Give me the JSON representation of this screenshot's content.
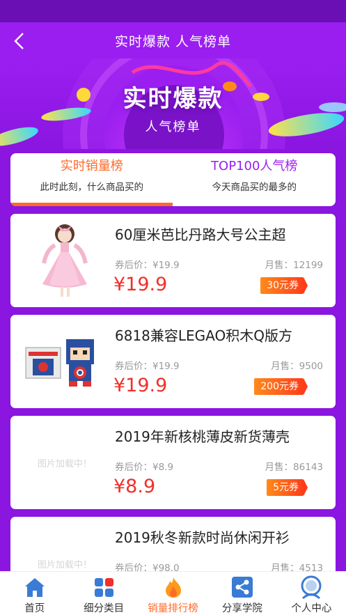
{
  "header": {
    "title": "实时爆款 人气榜单"
  },
  "banner": {
    "title": "实时爆款",
    "subtitle": "人气榜单"
  },
  "tabs": [
    {
      "title": "实时销量榜",
      "subtitle": "此时此刻，什么商品买的"
    },
    {
      "title": "TOP100人气榜",
      "subtitle": "今天商品买的最多的"
    }
  ],
  "products": [
    {
      "name": "60厘米芭比丹路大号公主超",
      "coupon_price": "券后价：¥19.9",
      "monthly_sales": "月售：12199",
      "price": "¥19.9",
      "coupon": "30元券",
      "image": "doll-image"
    },
    {
      "name": "6818兼容LEGAO积木Q版方",
      "coupon_price": "券后价：¥19.9",
      "monthly_sales": "月售：9500",
      "price": "¥19.9",
      "coupon": "200元券",
      "image": "lego-image"
    },
    {
      "name": "2019年新核桃薄皮新货薄壳",
      "coupon_price": "券后价：¥8.9",
      "monthly_sales": "月售：86143",
      "price": "¥8.9",
      "coupon": "5元券",
      "image_loading": "图片加载中！"
    },
    {
      "name": "2019秋冬新款时尚休闲开衫",
      "coupon_price": "券后价：¥98.0",
      "monthly_sales": "月售：4513",
      "image_loading": "图片加载中！"
    }
  ],
  "tabbar": [
    {
      "label": "首页",
      "icon": "home-icon"
    },
    {
      "label": "细分类目",
      "icon": "category-icon"
    },
    {
      "label": "销量排行榜",
      "icon": "flame-icon",
      "active": true
    },
    {
      "label": "分享学院",
      "icon": "share-icon"
    },
    {
      "label": "个人中心",
      "icon": "user-icon"
    }
  ],
  "colors": {
    "primary": "#9a1ef0",
    "accent": "#ff6a2b",
    "price": "#f0302a",
    "tabbar_icon": "#3a7bd5"
  }
}
